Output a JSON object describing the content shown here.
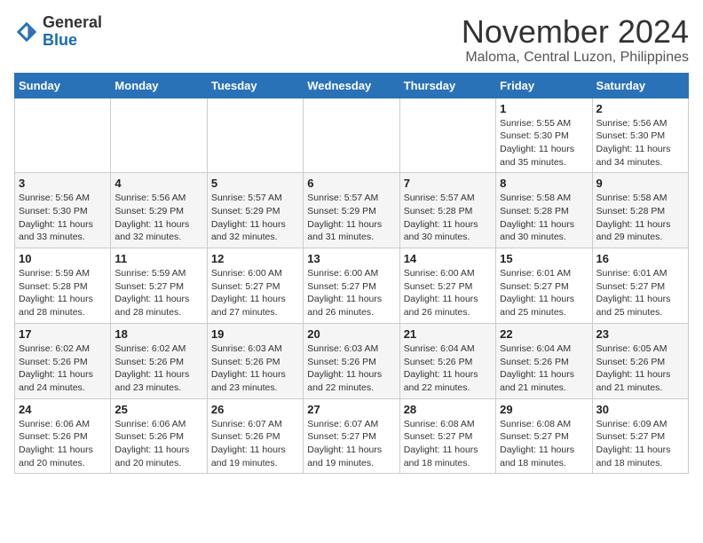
{
  "header": {
    "logo_general": "General",
    "logo_blue": "Blue",
    "title": "November 2024",
    "subtitle": "Maloma, Central Luzon, Philippines"
  },
  "weekdays": [
    "Sunday",
    "Monday",
    "Tuesday",
    "Wednesday",
    "Thursday",
    "Friday",
    "Saturday"
  ],
  "weeks": [
    [
      {
        "day": "",
        "info": ""
      },
      {
        "day": "",
        "info": ""
      },
      {
        "day": "",
        "info": ""
      },
      {
        "day": "",
        "info": ""
      },
      {
        "day": "",
        "info": ""
      },
      {
        "day": "1",
        "info": "Sunrise: 5:55 AM\nSunset: 5:30 PM\nDaylight: 11 hours and 35 minutes."
      },
      {
        "day": "2",
        "info": "Sunrise: 5:56 AM\nSunset: 5:30 PM\nDaylight: 11 hours and 34 minutes."
      }
    ],
    [
      {
        "day": "3",
        "info": "Sunrise: 5:56 AM\nSunset: 5:30 PM\nDaylight: 11 hours and 33 minutes."
      },
      {
        "day": "4",
        "info": "Sunrise: 5:56 AM\nSunset: 5:29 PM\nDaylight: 11 hours and 32 minutes."
      },
      {
        "day": "5",
        "info": "Sunrise: 5:57 AM\nSunset: 5:29 PM\nDaylight: 11 hours and 32 minutes."
      },
      {
        "day": "6",
        "info": "Sunrise: 5:57 AM\nSunset: 5:29 PM\nDaylight: 11 hours and 31 minutes."
      },
      {
        "day": "7",
        "info": "Sunrise: 5:57 AM\nSunset: 5:28 PM\nDaylight: 11 hours and 30 minutes."
      },
      {
        "day": "8",
        "info": "Sunrise: 5:58 AM\nSunset: 5:28 PM\nDaylight: 11 hours and 30 minutes."
      },
      {
        "day": "9",
        "info": "Sunrise: 5:58 AM\nSunset: 5:28 PM\nDaylight: 11 hours and 29 minutes."
      }
    ],
    [
      {
        "day": "10",
        "info": "Sunrise: 5:59 AM\nSunset: 5:28 PM\nDaylight: 11 hours and 28 minutes."
      },
      {
        "day": "11",
        "info": "Sunrise: 5:59 AM\nSunset: 5:27 PM\nDaylight: 11 hours and 28 minutes."
      },
      {
        "day": "12",
        "info": "Sunrise: 6:00 AM\nSunset: 5:27 PM\nDaylight: 11 hours and 27 minutes."
      },
      {
        "day": "13",
        "info": "Sunrise: 6:00 AM\nSunset: 5:27 PM\nDaylight: 11 hours and 26 minutes."
      },
      {
        "day": "14",
        "info": "Sunrise: 6:00 AM\nSunset: 5:27 PM\nDaylight: 11 hours and 26 minutes."
      },
      {
        "day": "15",
        "info": "Sunrise: 6:01 AM\nSunset: 5:27 PM\nDaylight: 11 hours and 25 minutes."
      },
      {
        "day": "16",
        "info": "Sunrise: 6:01 AM\nSunset: 5:27 PM\nDaylight: 11 hours and 25 minutes."
      }
    ],
    [
      {
        "day": "17",
        "info": "Sunrise: 6:02 AM\nSunset: 5:26 PM\nDaylight: 11 hours and 24 minutes."
      },
      {
        "day": "18",
        "info": "Sunrise: 6:02 AM\nSunset: 5:26 PM\nDaylight: 11 hours and 23 minutes."
      },
      {
        "day": "19",
        "info": "Sunrise: 6:03 AM\nSunset: 5:26 PM\nDaylight: 11 hours and 23 minutes."
      },
      {
        "day": "20",
        "info": "Sunrise: 6:03 AM\nSunset: 5:26 PM\nDaylight: 11 hours and 22 minutes."
      },
      {
        "day": "21",
        "info": "Sunrise: 6:04 AM\nSunset: 5:26 PM\nDaylight: 11 hours and 22 minutes."
      },
      {
        "day": "22",
        "info": "Sunrise: 6:04 AM\nSunset: 5:26 PM\nDaylight: 11 hours and 21 minutes."
      },
      {
        "day": "23",
        "info": "Sunrise: 6:05 AM\nSunset: 5:26 PM\nDaylight: 11 hours and 21 minutes."
      }
    ],
    [
      {
        "day": "24",
        "info": "Sunrise: 6:06 AM\nSunset: 5:26 PM\nDaylight: 11 hours and 20 minutes."
      },
      {
        "day": "25",
        "info": "Sunrise: 6:06 AM\nSunset: 5:26 PM\nDaylight: 11 hours and 20 minutes."
      },
      {
        "day": "26",
        "info": "Sunrise: 6:07 AM\nSunset: 5:26 PM\nDaylight: 11 hours and 19 minutes."
      },
      {
        "day": "27",
        "info": "Sunrise: 6:07 AM\nSunset: 5:27 PM\nDaylight: 11 hours and 19 minutes."
      },
      {
        "day": "28",
        "info": "Sunrise: 6:08 AM\nSunset: 5:27 PM\nDaylight: 11 hours and 18 minutes."
      },
      {
        "day": "29",
        "info": "Sunrise: 6:08 AM\nSunset: 5:27 PM\nDaylight: 11 hours and 18 minutes."
      },
      {
        "day": "30",
        "info": "Sunrise: 6:09 AM\nSunset: 5:27 PM\nDaylight: 11 hours and 18 minutes."
      }
    ]
  ]
}
